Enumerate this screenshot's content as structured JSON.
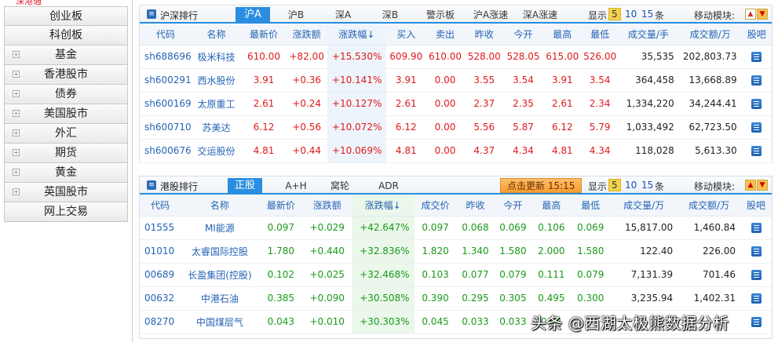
{
  "sidebar": {
    "top_partial": "深港通",
    "items": [
      "创业板",
      "科创板",
      "基金",
      "香港股市",
      "债券",
      "美国股市",
      "外汇",
      "期货",
      "黄金",
      "英国股市",
      "网上交易"
    ],
    "expandable": [
      false,
      false,
      true,
      true,
      true,
      true,
      true,
      true,
      true,
      true,
      false
    ]
  },
  "a_panel": {
    "title": "沪深排行",
    "tabs": [
      "沪A",
      "沪B",
      "深A",
      "深B",
      "警示板",
      "沪A涨速",
      "深A涨速"
    ],
    "active_tab": "沪A",
    "show_label": "显示",
    "count_options": [
      "5",
      "10",
      "15"
    ],
    "count_selected": "5",
    "count_unit": "条",
    "move_label": "移动模块:",
    "columns": [
      "代码",
      "名称",
      "最新价",
      "涨跌额",
      "涨跌幅",
      "买入",
      "卖出",
      "昨收",
      "今开",
      "最高",
      "最低",
      "成交量/手",
      "成交额/万",
      "股吧"
    ],
    "sort_arrow": "↓",
    "rows": [
      {
        "code": "sh688696",
        "name": "极米科技",
        "price": "610.00",
        "chg": "+82.00",
        "pct": "+15.530%",
        "bid": "609.90",
        "ask": "610.00",
        "prev": "528.00",
        "open": "528.05",
        "high": "615.00",
        "low": "526.00",
        "vol": "35,535",
        "amt": "202,803.73"
      },
      {
        "code": "sh600291",
        "name": "西水股份",
        "price": "3.91",
        "chg": "+0.36",
        "pct": "+10.141%",
        "bid": "3.91",
        "ask": "0.00",
        "prev": "3.55",
        "open": "3.54",
        "high": "3.91",
        "low": "3.54",
        "vol": "364,458",
        "amt": "13,668.89"
      },
      {
        "code": "sh600169",
        "name": "太原重工",
        "price": "2.61",
        "chg": "+0.24",
        "pct": "+10.127%",
        "bid": "2.61",
        "ask": "0.00",
        "prev": "2.37",
        "open": "2.35",
        "high": "2.61",
        "low": "2.34",
        "vol": "1,334,220",
        "amt": "34,244.41"
      },
      {
        "code": "sh600710",
        "name": "苏美达",
        "price": "6.12",
        "chg": "+0.56",
        "pct": "+10.072%",
        "bid": "6.12",
        "ask": "0.00",
        "prev": "5.56",
        "open": "5.87",
        "high": "6.12",
        "low": "5.79",
        "vol": "1,033,492",
        "amt": "62,723.50"
      },
      {
        "code": "sh600676",
        "name": "交运股份",
        "price": "4.81",
        "chg": "+0.44",
        "pct": "+10.069%",
        "bid": "4.81",
        "ask": "0.00",
        "prev": "4.37",
        "open": "4.34",
        "high": "4.81",
        "low": "4.34",
        "vol": "118,028",
        "amt": "5,613.30"
      }
    ]
  },
  "h_panel": {
    "title": "港股排行",
    "tabs": [
      "正股",
      "A+H",
      "窝轮",
      "ADR"
    ],
    "active_tab": "正股",
    "refresh_label": "点击更新 15:15",
    "show_label": "显示",
    "count_options": [
      "5",
      "10",
      "15"
    ],
    "count_selected": "5",
    "count_unit": "条",
    "move_label": "移动模块:",
    "columns": [
      "代码",
      "名称",
      "最新价",
      "涨跌额",
      "涨跌幅",
      "成交价",
      "昨收",
      "今开",
      "最高",
      "最低",
      "成交量/万",
      "成交额/万",
      "股吧"
    ],
    "sort_arrow": "↓",
    "rows": [
      {
        "code": "01555",
        "name": "MI能源",
        "price": "0.097",
        "chg": "+0.029",
        "pct": "+42.647%",
        "deal": "0.097",
        "prev": "0.068",
        "open": "0.069",
        "high": "0.106",
        "low": "0.069",
        "vol": "15,817.00",
        "amt": "1,460.84"
      },
      {
        "code": "01010",
        "name": "太睿国际控股",
        "price": "1.780",
        "chg": "+0.440",
        "pct": "+32.836%",
        "deal": "1.820",
        "prev": "1.340",
        "open": "1.580",
        "high": "2.000",
        "low": "1.580",
        "vol": "122.40",
        "amt": "226.00"
      },
      {
        "code": "00689",
        "name": "长盈集团(控股)",
        "price": "0.102",
        "chg": "+0.025",
        "pct": "+32.468%",
        "deal": "0.103",
        "prev": "0.077",
        "open": "0.079",
        "high": "0.111",
        "low": "0.079",
        "vol": "7,131.39",
        "amt": "701.46"
      },
      {
        "code": "00632",
        "name": "中港石油",
        "price": "0.385",
        "chg": "+0.090",
        "pct": "+30.508%",
        "deal": "0.390",
        "prev": "0.295",
        "open": "0.305",
        "high": "0.495",
        "low": "0.300",
        "vol": "3,235.94",
        "amt": "1,402.31"
      },
      {
        "code": "08270",
        "name": "中国煤层气",
        "price": "0.043",
        "chg": "+0.010",
        "pct": "+30.303%",
        "deal": "0.045",
        "prev": "0.033",
        "open": "0.033",
        "high": "0.04",
        "low": "",
        "vol": "",
        "amt": ""
      }
    ]
  },
  "watermark": "头条 @西湖太极熊数据分析",
  "colors": {
    "accent": "#2a8de0",
    "up_red": "#e0191b",
    "up_green": "#1a9a1a",
    "link_blue": "#2463b5"
  }
}
